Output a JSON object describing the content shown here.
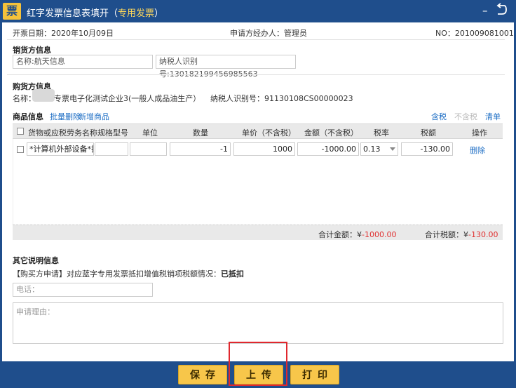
{
  "window": {
    "logo_char": "票",
    "title": "红字发票信息表填开（",
    "title_tag": "专用发票",
    "title_end": "）",
    "minimize_glyph": "–",
    "close_glyph": "↺"
  },
  "meta": {
    "date_label": "开票日期：2020年10月09日",
    "applicant_label": "申请方经办人：管理员",
    "no_label": "NO：201009081001"
  },
  "seller": {
    "section_title": "销货方信息",
    "name_value": "名称:航天信息",
    "taxid_value": "纳税人识别号:130182199456985563"
  },
  "buyer": {
    "section_title": "购货方信息",
    "name_label": "名称：",
    "name_value": "专票电子化测试企业3(一般人成品油生产）",
    "taxid_value": "纳税人识别号：91130108CS00000023"
  },
  "goods": {
    "section_title": "商品信息",
    "batch_delete": "批量删除",
    "add_goods": "新增商品",
    "tax_included": "含税",
    "tax_excluded": "不含税",
    "clear": "清单",
    "columns": [
      "货物或应税劳务名称",
      "规格型号",
      "单位",
      "数量",
      "单价（不含税）",
      "金额（不含税）",
      "税率",
      "税额",
      "操作"
    ],
    "row": {
      "name": "*计算机外部设备*打",
      "spec": "",
      "unit": "",
      "quantity": "-1",
      "price": "1000",
      "amount": "-1000.00",
      "rate": "0.13",
      "tax": "-130.00",
      "action": "删除"
    },
    "total_amount_label": "合计金额：¥",
    "total_amount": "-1000.00",
    "total_tax_label": "合计税额：¥",
    "total_tax": "-130.00"
  },
  "other": {
    "section_title": "其它说明信息",
    "buyer_apply": "【购买方申请】",
    "apply_desc": "对应蓝字专用发票抵扣增值税销项税额情况：",
    "apply_status": "已抵扣",
    "phone_placeholder": "电话：",
    "reason_placeholder": "申请理由："
  },
  "actions": {
    "save": "保存",
    "upload": "上传",
    "print": "打印"
  },
  "colors": {
    "brand": "#1f4e8c",
    "button": "#f7c64a",
    "highlight": "#e0282e",
    "negative": "#e03030"
  }
}
